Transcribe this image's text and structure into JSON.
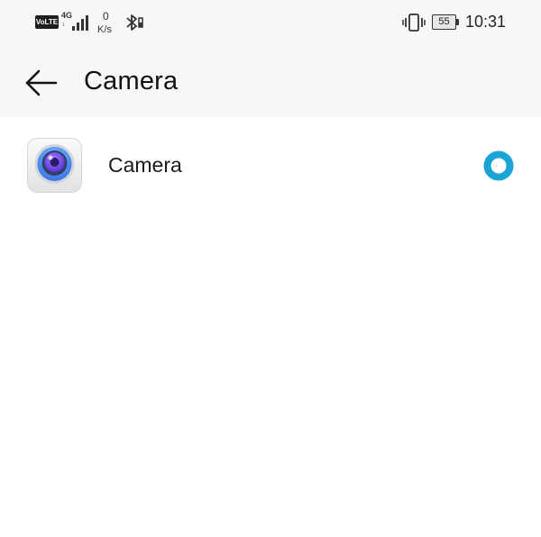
{
  "status_bar": {
    "network_badge": "VoLTE",
    "network_type": "4G",
    "network_sub": "1",
    "speed_value": "0",
    "speed_unit": "K/s",
    "battery_level": "55",
    "time": "10:31",
    "icons": [
      "volte-icon",
      "cellular-signal-icon",
      "bluetooth-icon",
      "vibrate-icon",
      "battery-icon"
    ]
  },
  "app_bar": {
    "title": "Camera",
    "back_icon": "back-arrow-icon"
  },
  "list": {
    "items": [
      {
        "label": "Camera",
        "icon": "camera-app-icon",
        "selected": true
      }
    ]
  },
  "colors": {
    "accent": "#1aa4d6",
    "header_bg": "#f7f7f7",
    "background": "#ffffff"
  }
}
